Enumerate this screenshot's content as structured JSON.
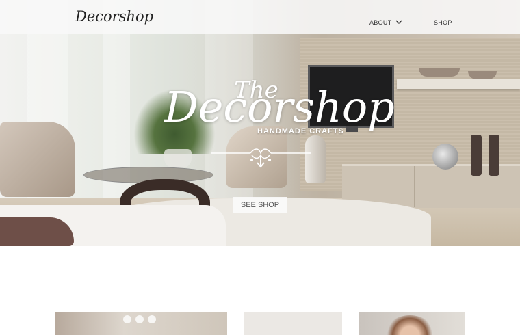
{
  "nav": {
    "brand": "Decorshop",
    "items": [
      {
        "label": "ABOUT",
        "has_dropdown": true
      },
      {
        "label": "SHOP",
        "has_dropdown": false
      }
    ]
  },
  "hero": {
    "logo_the": "The",
    "logo_main": "Decorshop",
    "tagline": "HANDMADE CRAFTS",
    "cta_label": "SEE SHOP"
  },
  "icons": {
    "dropdown": "chevron-down-icon",
    "ornament": "ornament-divider"
  },
  "colors": {
    "nav_bg": "#f8f8f8",
    "text_dark": "#222222",
    "logo_text": "#ffffff",
    "cta_bg": "#fafafa"
  }
}
